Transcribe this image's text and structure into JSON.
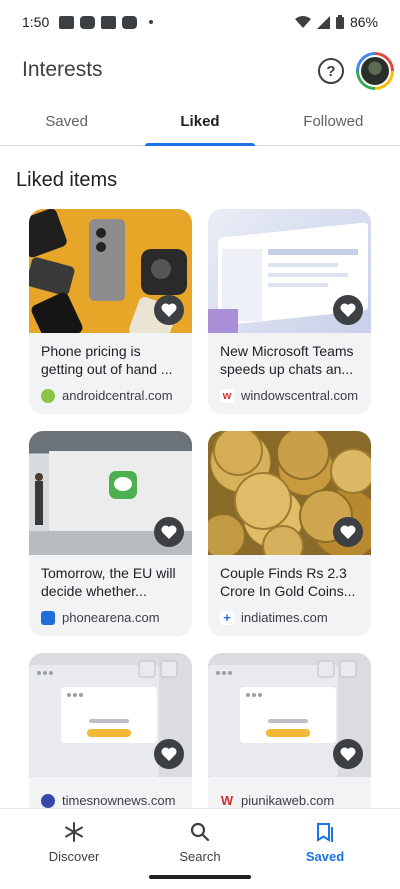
{
  "status": {
    "time": "1:50",
    "battery": "86%"
  },
  "header": {
    "title": "Interests",
    "help_icon": "help-circle-icon",
    "avatar_icon": "account-avatar"
  },
  "tabs": [
    {
      "label": "Saved",
      "active": false
    },
    {
      "label": "Liked",
      "active": true
    },
    {
      "label": "Followed",
      "active": false
    }
  ],
  "section_title": "Liked items",
  "cards": [
    {
      "headline": "Phone pricing is getting out of hand ...",
      "source": "androidcentral.com"
    },
    {
      "headline": "New Microsoft Teams speeds up chats an...",
      "source": "windowscentral.com"
    },
    {
      "headline": "Tomorrow, the EU will decide whether...",
      "source": "phonearena.com"
    },
    {
      "headline": "Couple Finds Rs 2.3 Crore In Gold Coins...",
      "source": "indiatimes.com"
    },
    {
      "headline": "",
      "source": "timesnownews.com"
    },
    {
      "headline": "",
      "source": "piunikaweb.com"
    }
  ],
  "teams_img_text": "Messages",
  "nav": [
    {
      "label": "Discover",
      "icon": "asterisk-icon"
    },
    {
      "label": "Search",
      "icon": "search-icon"
    },
    {
      "label": "Saved",
      "icon": "bookmark-icon",
      "active": true
    }
  ],
  "colors": {
    "accent": "#1a73e8",
    "text": "#202124",
    "card_bg": "#f1f3f4"
  }
}
